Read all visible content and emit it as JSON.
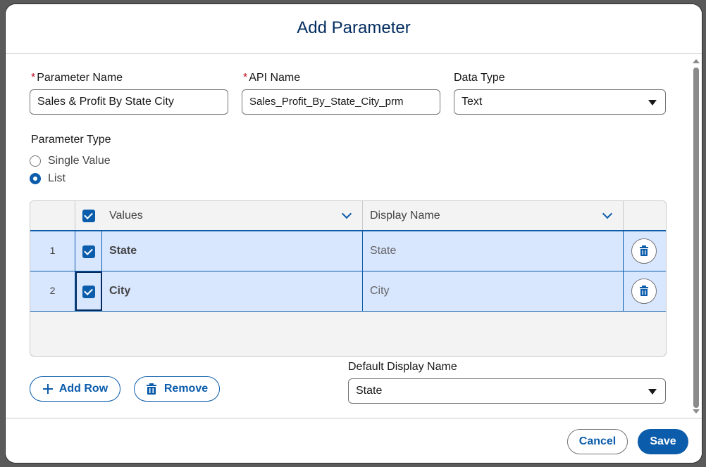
{
  "dialog": {
    "title": "Add Parameter"
  },
  "form": {
    "parameter_name": {
      "label": "Parameter Name",
      "required_mark": "*",
      "value": "Sales & Profit By State City"
    },
    "api_name": {
      "label": "API Name",
      "required_mark": "*",
      "value": "Sales_Profit_By_State_City_prm"
    },
    "data_type": {
      "label": "Data Type",
      "value": "Text"
    },
    "parameter_type": {
      "label": "Parameter Type",
      "options": [
        {
          "label": "Single Value",
          "checked": false
        },
        {
          "label": "List",
          "checked": true
        }
      ]
    },
    "default_display_name": {
      "label": "Default Display Name",
      "value": "State"
    }
  },
  "grid": {
    "columns": [
      "Values",
      "Display Name"
    ],
    "rows": [
      {
        "num": "1",
        "value": "State",
        "display": "State",
        "selected": true
      },
      {
        "num": "2",
        "value": "City",
        "display": "City",
        "selected": true
      }
    ]
  },
  "actions": {
    "add_row": "Add Row",
    "remove": "Remove"
  },
  "footer": {
    "cancel": "Cancel",
    "save": "Save"
  },
  "colors": {
    "brand": "#0b5cab",
    "title": "#032d60",
    "row_selected": "#d8e6fe",
    "required": "#ba0517"
  }
}
